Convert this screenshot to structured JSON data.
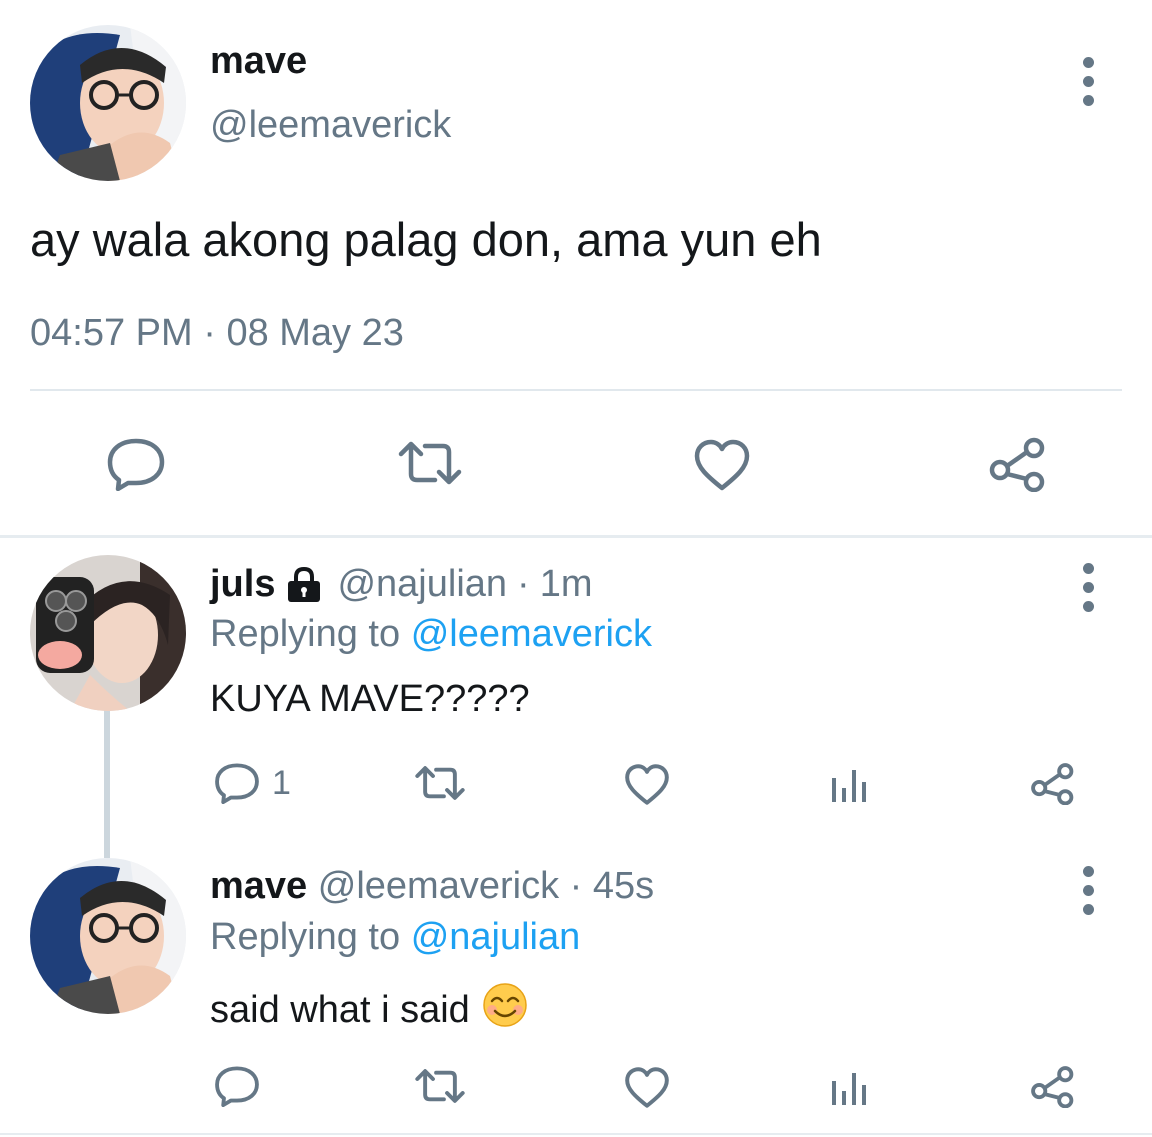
{
  "main_tweet": {
    "display_name": "mave",
    "handle": "@leemaverick",
    "text": "ay wala akong palag don, ama yun eh",
    "time": "04:57 PM",
    "separator": "·",
    "date": "08 May 23",
    "actions": [
      "reply-icon",
      "retweet-icon",
      "like-icon",
      "share-icon"
    ]
  },
  "replies": [
    {
      "display_name": "juls",
      "locked": true,
      "handle": "@najulian",
      "time_sep": "·",
      "time": "1m",
      "replying_prefix": "Replying to",
      "replying_to": "@leemaverick",
      "text": "KUYA MAVE?????",
      "reply_count": "1"
    },
    {
      "display_name": "mave",
      "handle": "@leemaverick",
      "time_sep": "·",
      "time": "45s",
      "replying_prefix": "Replying to",
      "replying_to": "@najulian",
      "text": "said what i said",
      "emoji": "😊",
      "reply_count": ""
    }
  ],
  "colors": {
    "text": "#14171a",
    "secondary": "#657786",
    "link": "#1da1f2",
    "divider": "#e1e8ed"
  }
}
